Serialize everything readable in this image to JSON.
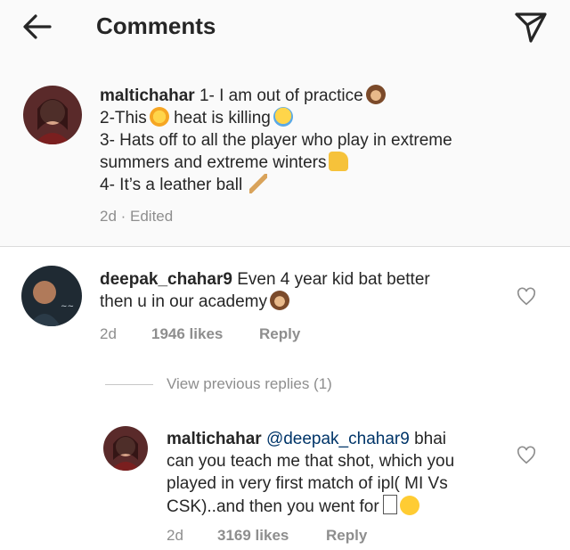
{
  "header": {
    "title": "Comments",
    "back_icon": "arrow-left-icon",
    "share_icon": "paper-plane-icon"
  },
  "caption": {
    "username": "maltichahar",
    "lines": [
      "1- I am out of practice",
      "2-This",
      "heat is killing",
      "3- Hats off to all the player who play in extreme",
      "summers and extreme winters",
      "4- It’s a leather ball"
    ],
    "meta": "2d · Edited"
  },
  "comment": {
    "username": "deepak_chahar9",
    "text_line1": "Even 4 year kid bat better",
    "text_line2": "then u in our academy",
    "time": "2d",
    "likes": "1946 likes",
    "reply_label": "Reply"
  },
  "view_previous": "View previous replies (1)",
  "reply": {
    "username": "maltichahar",
    "mention": "@deepak_chahar9",
    "text_after_mention": "bhai",
    "text_line2": "can you teach me that shot, which you",
    "text_line3": "played in very first match of ipl( MI Vs",
    "text_line4": "CSK)..and then you went for",
    "time": "2d",
    "likes": "3169 likes",
    "reply_label": "Reply"
  },
  "colors": {
    "text": "#262626",
    "muted": "#8e8e8e",
    "link": "#003569",
    "header_bg": "#fafafa"
  }
}
